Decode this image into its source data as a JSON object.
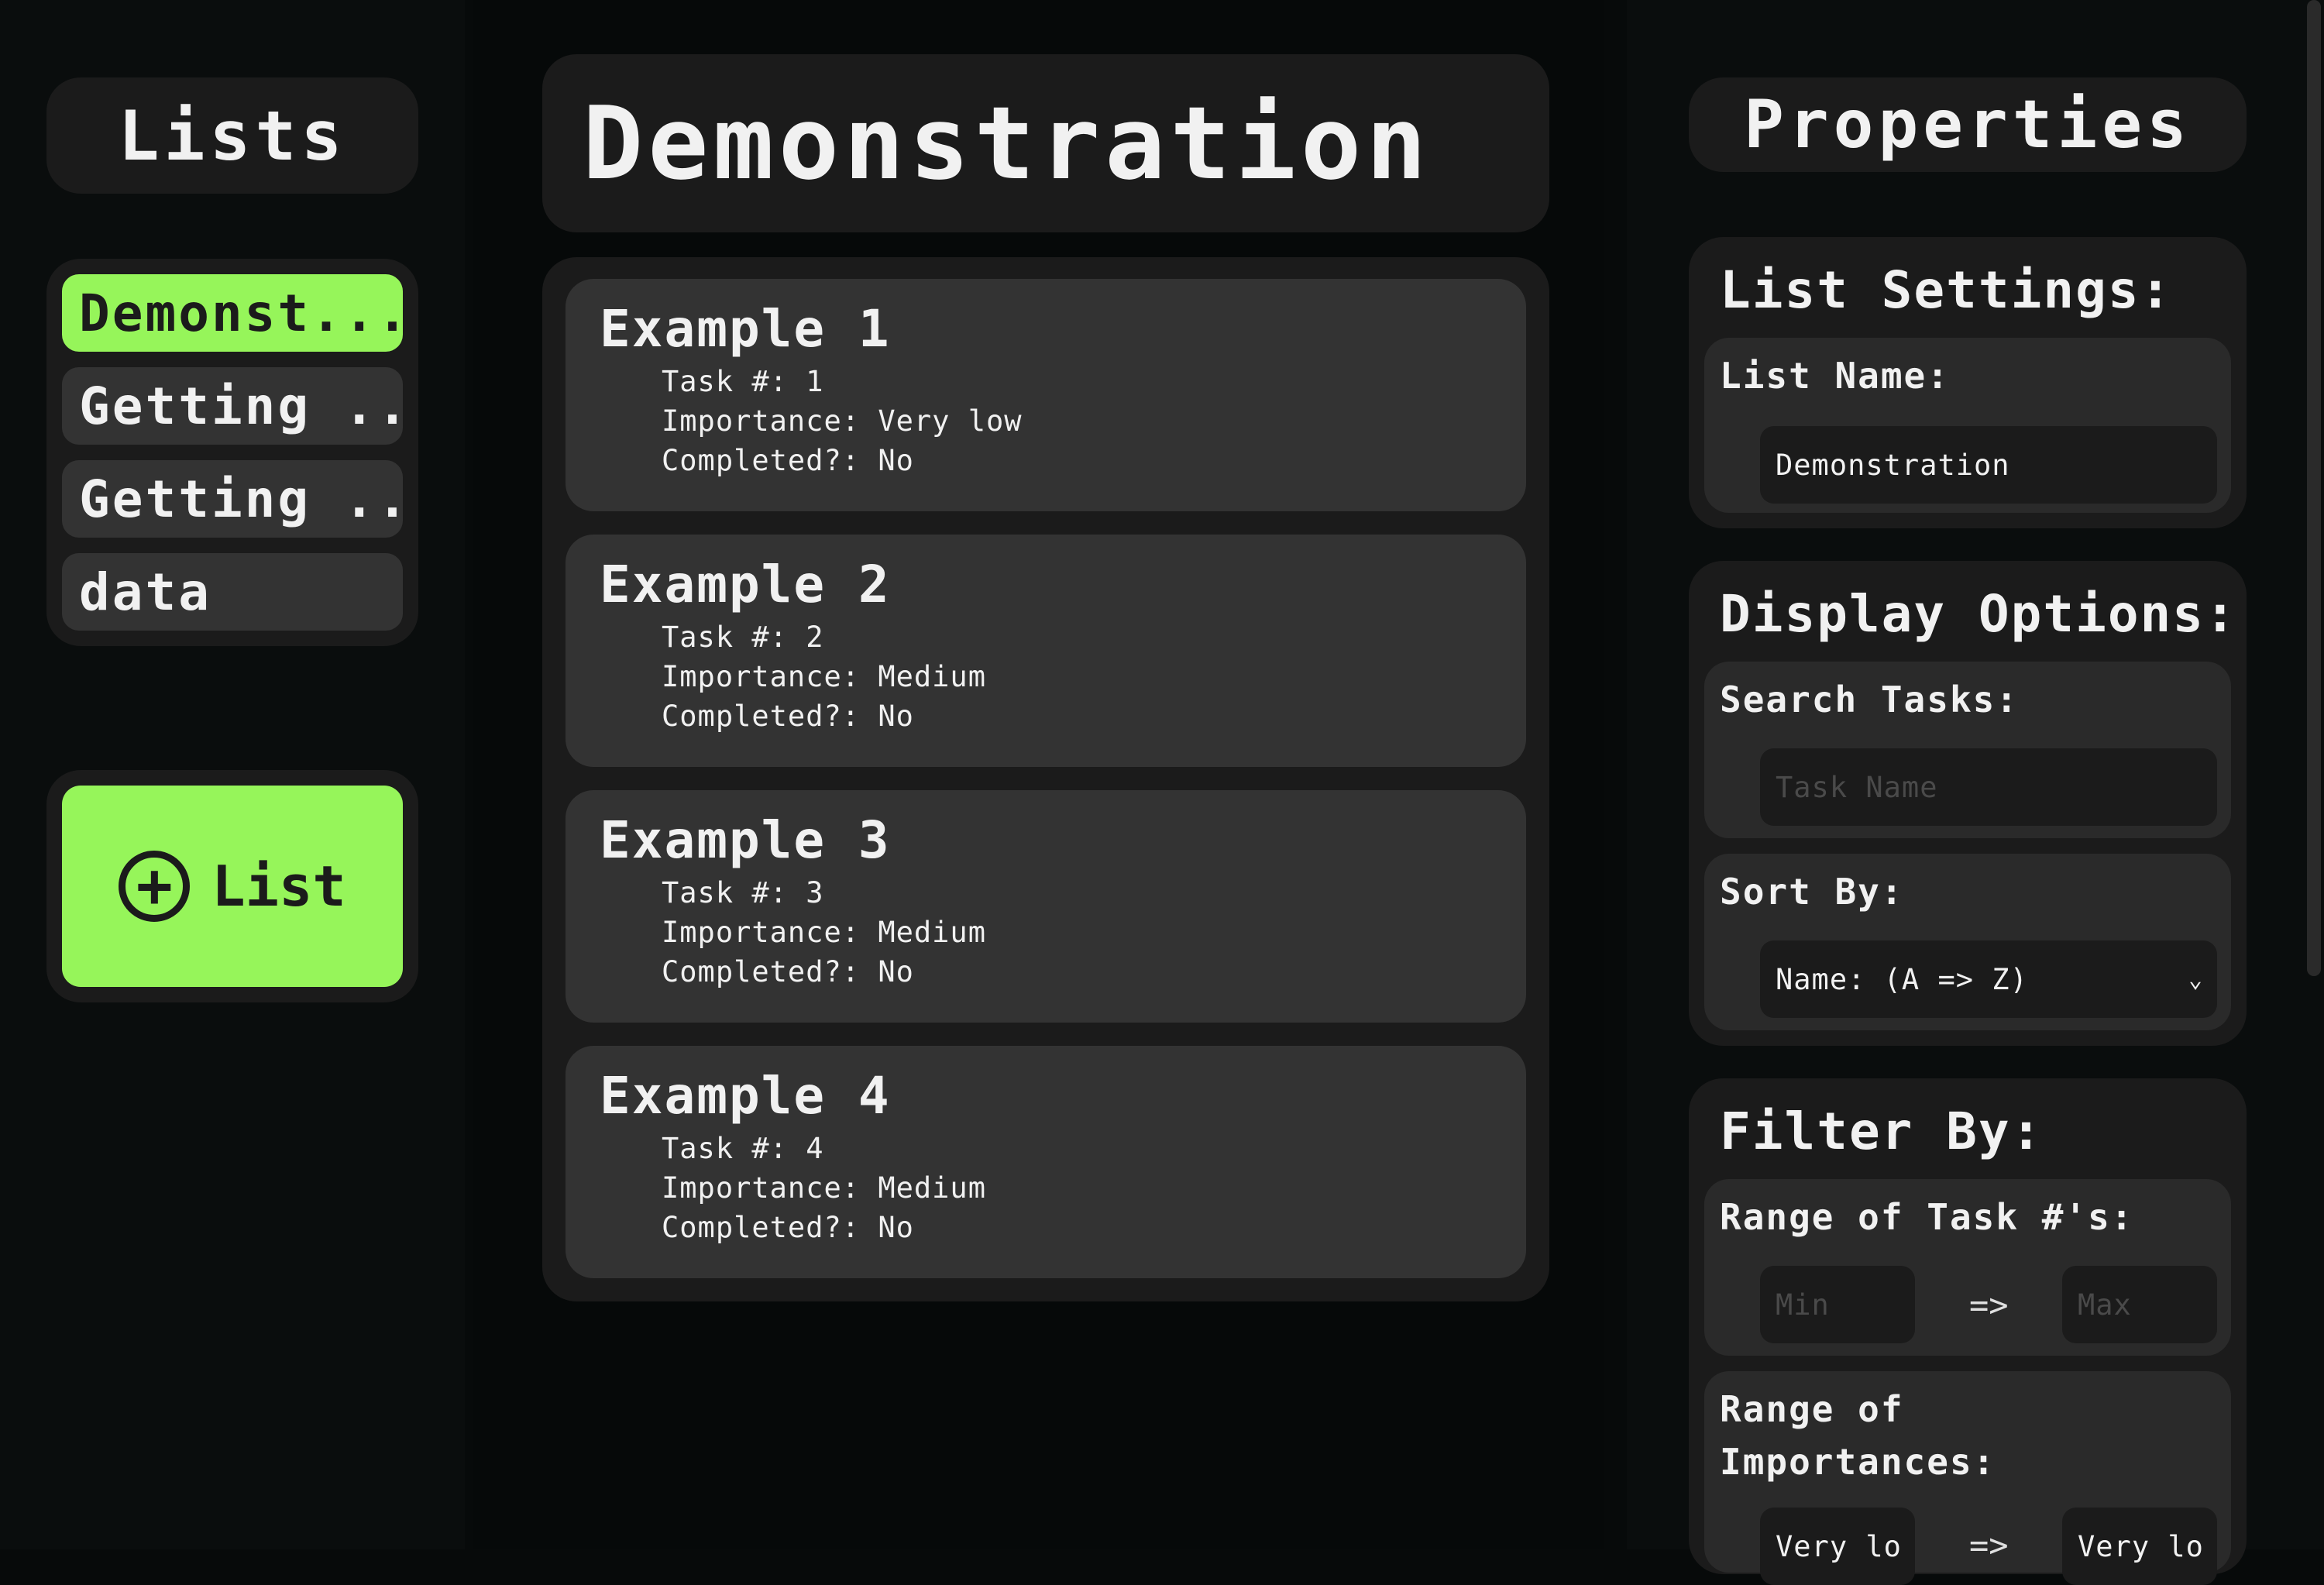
{
  "sidebar": {
    "header": "Lists",
    "items": [
      {
        "label": "Demonst...",
        "active": true
      },
      {
        "label": "Getting ..."
      },
      {
        "label": "Getting ..."
      },
      {
        "label": "data"
      }
    ],
    "add_list_label": "List"
  },
  "main": {
    "title": "Demonstration",
    "field_labels": {
      "task_num": "Task #:",
      "importance": "Importance:",
      "completed": "Completed?:"
    },
    "tasks": [
      {
        "title": "Example 1",
        "task_num": "1",
        "importance": "Very low",
        "completed": "No"
      },
      {
        "title": "Example 2",
        "task_num": "2",
        "importance": "Medium",
        "completed": "No"
      },
      {
        "title": "Example 3",
        "task_num": "3",
        "importance": "Medium",
        "completed": "No"
      },
      {
        "title": "Example 4",
        "task_num": "4",
        "importance": "Medium",
        "completed": "No"
      }
    ]
  },
  "properties": {
    "header": "Properties",
    "list_settings": {
      "title": "List Settings:",
      "list_name_label": "List Name:",
      "list_name_value": "Demonstration"
    },
    "display_options": {
      "title": "Display Options:",
      "search_label": "Search Tasks:",
      "search_placeholder": "Task Name",
      "sort_label": "Sort By:",
      "sort_value": "Name: (A => Z)"
    },
    "filter_by": {
      "title": "Filter By:",
      "task_range_label": "Range of Task #'s:",
      "min_placeholder": "Min",
      "range_arrow": "=>",
      "max_placeholder": "Max",
      "importance_range_label_1": "Range of",
      "importance_range_label_2": "Importances:",
      "importance_min_value": "Very lo",
      "importance_max_value": "Very lo"
    }
  },
  "colors": {
    "accent": "#96f55a",
    "panel": "#1b1b1b",
    "card": "#333333",
    "background": "#070a0a"
  }
}
